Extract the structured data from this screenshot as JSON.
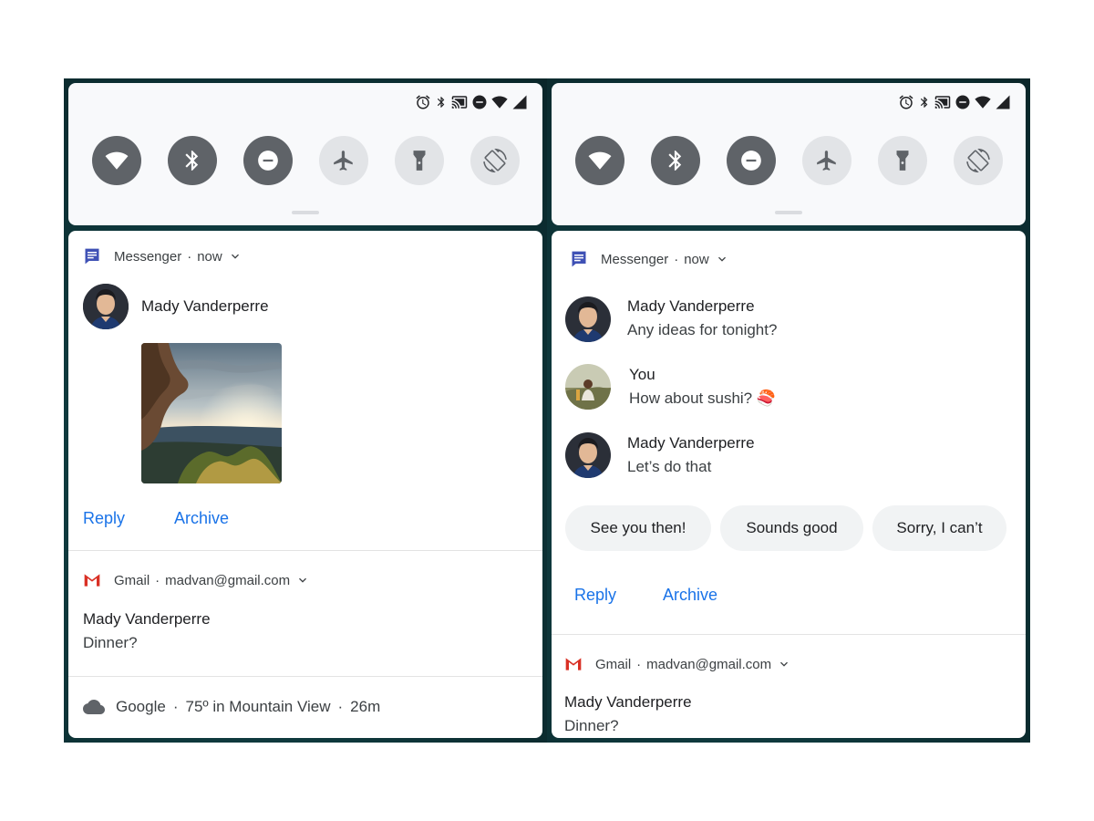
{
  "left": {
    "messenger": {
      "app_name": "Messenger",
      "time": "now",
      "sender": "Mady Vanderperre",
      "actions": [
        "Reply",
        "Archive"
      ]
    },
    "gmail": {
      "app_name": "Gmail",
      "account": "madvan@gmail.com",
      "sender": "Mady Vanderperre",
      "subject": "Dinner?"
    },
    "weather": {
      "app_name": "Google",
      "summary": "75º in Mountain View",
      "time": "26m"
    }
  },
  "right": {
    "messenger": {
      "app_name": "Messenger",
      "time": "now",
      "messages": [
        {
          "sender": "Mady Vanderperre",
          "text": "Any ideas for tonight?"
        },
        {
          "sender": "You",
          "text": "How about sushi? 🍣"
        },
        {
          "sender": "Mady Vanderperre",
          "text": "Let’s do that"
        }
      ],
      "smart_replies": [
        "See you then!",
        "Sounds good",
        "Sorry, I can’t"
      ],
      "actions": [
        "Reply",
        "Archive"
      ]
    },
    "gmail": {
      "app_name": "Gmail",
      "account": "madvan@gmail.com",
      "sender": "Mady Vanderperre",
      "subject": "Dinner?"
    }
  },
  "quick_settings": {
    "tiles": [
      {
        "icon": "wifi-icon",
        "state": "on"
      },
      {
        "icon": "bluetooth-icon",
        "state": "on"
      },
      {
        "icon": "do-not-disturb-icon",
        "state": "on"
      },
      {
        "icon": "airplane-icon",
        "state": "off"
      },
      {
        "icon": "flashlight-icon",
        "state": "off"
      },
      {
        "icon": "auto-rotate-icon",
        "state": "off"
      }
    ],
    "status_icons": [
      "alarm-icon",
      "bluetooth-icon",
      "cast-icon",
      "do-not-disturb-icon",
      "wifi-icon",
      "signal-icon"
    ]
  },
  "colors": {
    "accent": "#1a73e8",
    "tile_on": "#5f6368",
    "tile_off": "#e2e4e7",
    "gmail_red": "#d93025",
    "messenger_blue": "#3f51b5"
  }
}
